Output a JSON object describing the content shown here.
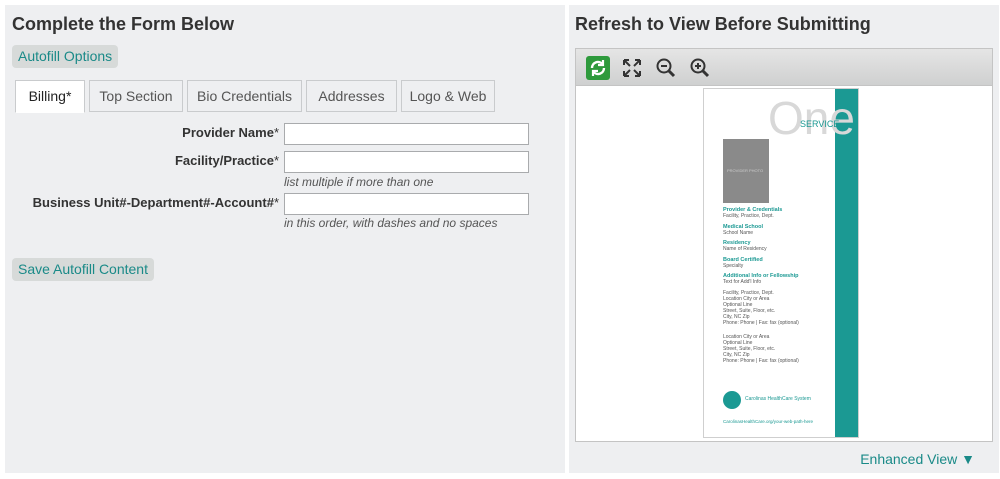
{
  "left": {
    "title": "Complete the Form Below",
    "autofill_options_label": "Autofill Options",
    "tabs": [
      {
        "label": "Billing*",
        "active": true
      },
      {
        "label": "Top Section",
        "active": false
      },
      {
        "label": "Bio Credentials",
        "active": false
      },
      {
        "label": "Addresses",
        "active": false
      },
      {
        "label": "Logo & Web",
        "active": false
      }
    ],
    "fields": {
      "provider_name": {
        "label": "Provider Name",
        "required": "*",
        "value": ""
      },
      "facility": {
        "label": "Facility/Practice",
        "required": "*",
        "value": "",
        "hint": "list multiple if more than one"
      },
      "business_unit": {
        "label": "Business Unit#-Department#-Account#",
        "required": "*",
        "value": "",
        "hint": "in this order, with dashes and no spaces"
      }
    },
    "save_label": "Save Autofill Content"
  },
  "right": {
    "title": "Refresh to View Before Submitting",
    "toolbar": [
      "refresh-icon",
      "fullscreen-icon",
      "zoom-out-icon",
      "zoom-in-icon"
    ],
    "enhanced_view_label": "Enhanced View ▼",
    "document": {
      "big_word": "One",
      "service": "SERVICE",
      "photo_label": "PROVIDER PHOTO",
      "sections": [
        {
          "heading": "Provider & Credentials",
          "lines": [
            "Facility, Practice, Dept."
          ]
        },
        {
          "heading": "Medical School",
          "lines": [
            "School Name"
          ]
        },
        {
          "heading": "Residency",
          "lines": [
            "Name of Residency"
          ]
        },
        {
          "heading": "Board Certified",
          "lines": [
            "Specialty"
          ]
        },
        {
          "heading": "Additional Info or Fellowship",
          "lines": [
            "Text for Add'l Info"
          ]
        }
      ],
      "address_block_1": [
        "Facility, Practice, Dept.",
        "Location City or Area",
        "Optional Line",
        "Street, Suite, Floor, etc.",
        "City, NC Zip",
        "Phone: Phone | Fax: fax (optional)"
      ],
      "address_block_2": [
        "Location City or Area",
        "Optional Line",
        "Street, Suite, Floor, etc.",
        "City, NC Zip",
        "Phone: Phone | Fax: fax (optional)"
      ],
      "logo_text": "Carolinas HealthCare System",
      "url": "CarolinasHealthCare.org/your-web-path-here"
    }
  },
  "colors": {
    "accent": "#1a8a88",
    "panel_bg": "#eeeff1",
    "refresh_green": "#2e9a3c"
  }
}
